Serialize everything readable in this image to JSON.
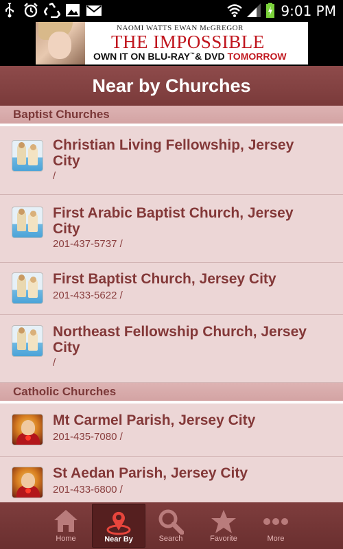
{
  "status_bar": {
    "time": "9:01 PM",
    "icons": [
      "usb-icon",
      "alarm-icon",
      "recycle-icon",
      "image-icon",
      "mail-icon",
      "wifi-icon",
      "signal-icon",
      "battery-charging-icon"
    ]
  },
  "ad": {
    "names": "NAOMI WATTS   EWAN McGREGOR",
    "title": "THE IMPOSSIBLE",
    "tagline_part1": "OWN IT ON BLU-RAY",
    "tagline_tm": "™",
    "tagline_part2": "& DVD",
    "tagline_highlight": "TOMORROW"
  },
  "header": {
    "title": "Near by Churches"
  },
  "sections": [
    {
      "title": "Baptist Churches",
      "icon": "baptism-icon",
      "items": [
        {
          "name_line1": "Christian Living Fellowship, Jersey",
          "name_line2": "City",
          "phone": "/"
        },
        {
          "name_line1": "First Arabic Baptist Church, Jersey",
          "name_line2": "City",
          "phone": "201-437-5737 /"
        },
        {
          "name_line1": "First Baptist Church, Jersey City",
          "name_line2": "",
          "phone": "201-433-5622 /"
        },
        {
          "name_line1": "Northeast Fellowship Church, Jersey",
          "name_line2": "City",
          "phone": "/"
        }
      ]
    },
    {
      "title": "Catholic Churches",
      "icon": "sacred-heart-icon",
      "items": [
        {
          "name_line1": "Mt Carmel Parish, Jersey City",
          "name_line2": "",
          "phone": "201-435-7080 /"
        },
        {
          "name_line1": "St Aedan Parish, Jersey City",
          "name_line2": "",
          "phone": "201-433-6800 /"
        }
      ]
    }
  ],
  "bottom_nav": {
    "items": [
      {
        "label": "Home",
        "icon": "home-icon"
      },
      {
        "label": "Near By",
        "icon": "map-pin-icon",
        "active": true
      },
      {
        "label": "Search",
        "icon": "search-icon"
      },
      {
        "label": "Favorite",
        "icon": "star-icon"
      },
      {
        "label": "More",
        "icon": "more-dots-icon"
      }
    ]
  },
  "colors": {
    "header": "#7e3d3d",
    "section_header": "#d7aaaa",
    "row_background": "#ecd6d6",
    "text": "#833838",
    "nav_active": "#551f1f",
    "nav_pin_accent": "#e8453c"
  }
}
